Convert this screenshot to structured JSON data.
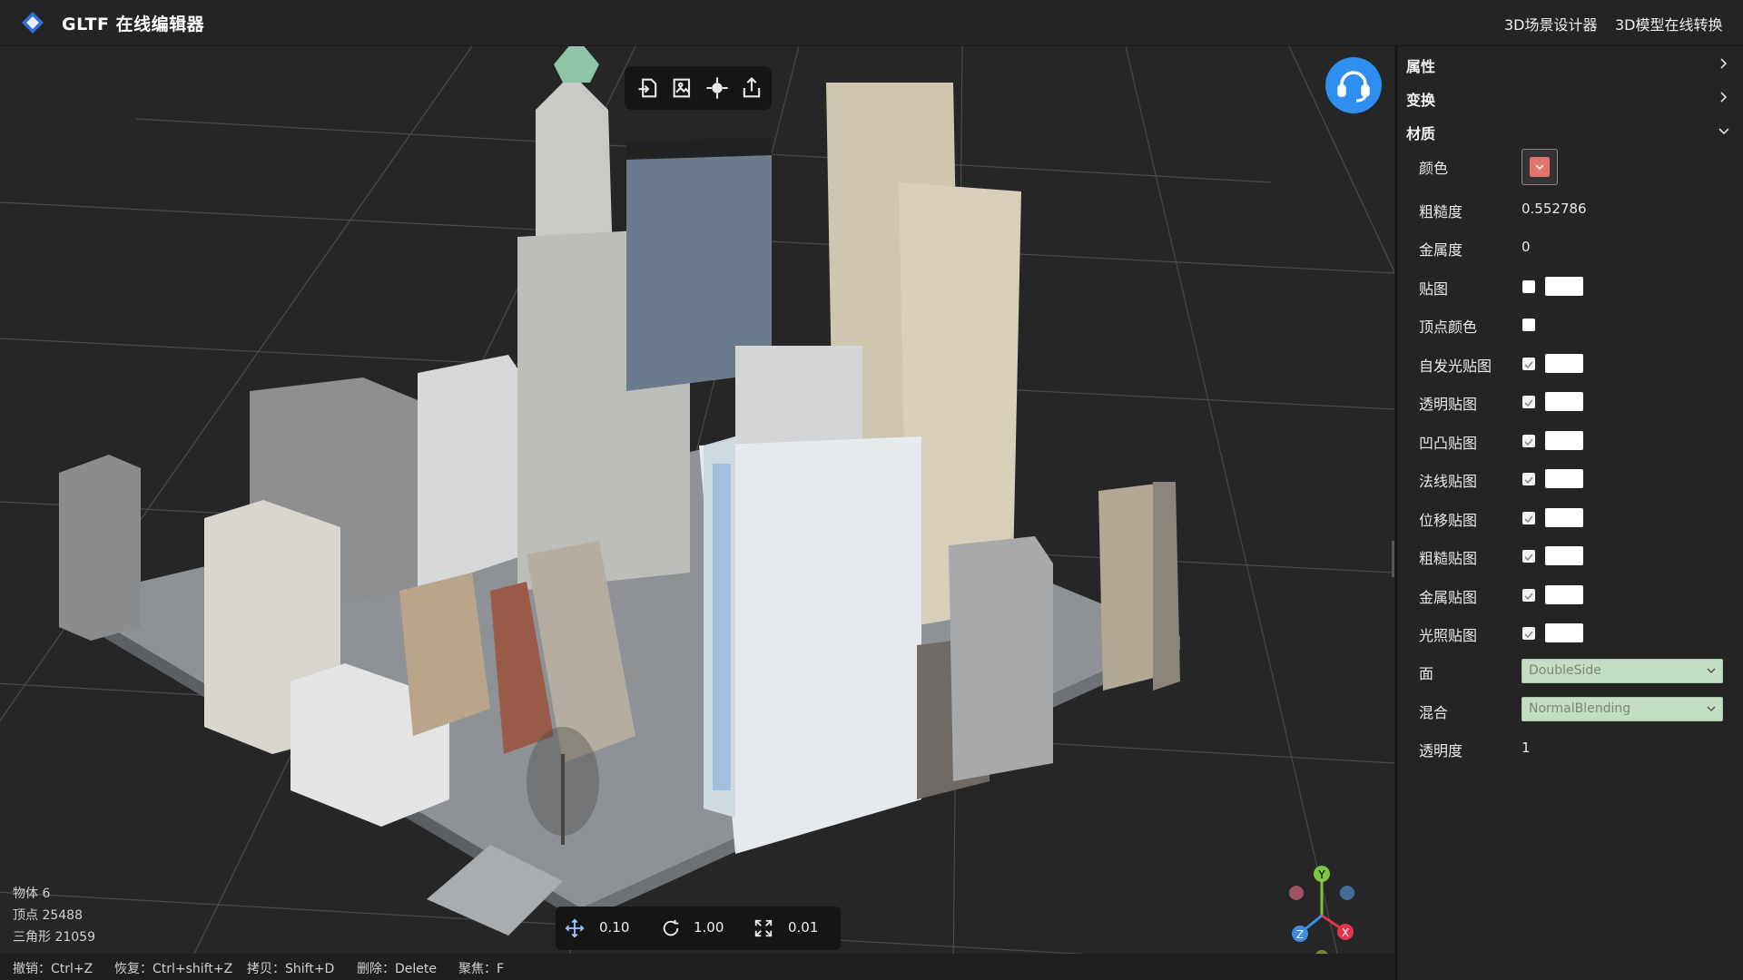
{
  "app": {
    "title": "GLTF 在线编辑器"
  },
  "header": {
    "links": [
      "3D场景设计器",
      "3D模型在线转换"
    ]
  },
  "viewport": {
    "stats": {
      "objects": "物体 6",
      "vertices": "顶点 25488",
      "triangles": "三角形 21059"
    },
    "transform": {
      "move": "0.10",
      "rotate": "1.00",
      "scale": "0.01"
    },
    "shortcuts": [
      "撤销：Ctrl+Z",
      "恢复：Ctrl+shift+Z",
      "拷贝：Shift+D",
      "删除：Delete",
      "聚焦：F"
    ]
  },
  "gizmo": {
    "x": "X",
    "y": "Y",
    "z": "Z"
  },
  "panel": {
    "sections": {
      "attributes": "属性",
      "transform": "变换",
      "material": "材质"
    },
    "material": {
      "color_label": "颜色",
      "roughness_label": "粗糙度",
      "roughness_value": "0.552786",
      "metalness_label": "金属度",
      "metalness_value": "0",
      "map_label": "贴图",
      "vertex_color_label": "顶点颜色",
      "emissive_map_label": "自发光贴图",
      "alpha_map_label": "透明贴图",
      "bump_map_label": "凹凸贴图",
      "normal_map_label": "法线贴图",
      "displacement_map_label": "位移贴图",
      "roughness_map_label": "粗糙贴图",
      "metalness_map_label": "金属贴图",
      "light_map_label": "光照贴图",
      "side_label": "面",
      "side_value": "DoubleSide",
      "blending_label": "混合",
      "blending_value": "NormalBlending",
      "opacity_label": "透明度",
      "opacity_value": "1"
    }
  },
  "colors": {
    "accent": "#2f8ff0",
    "material_color": "#e0736a",
    "select_bg": "#c3ddc3"
  }
}
